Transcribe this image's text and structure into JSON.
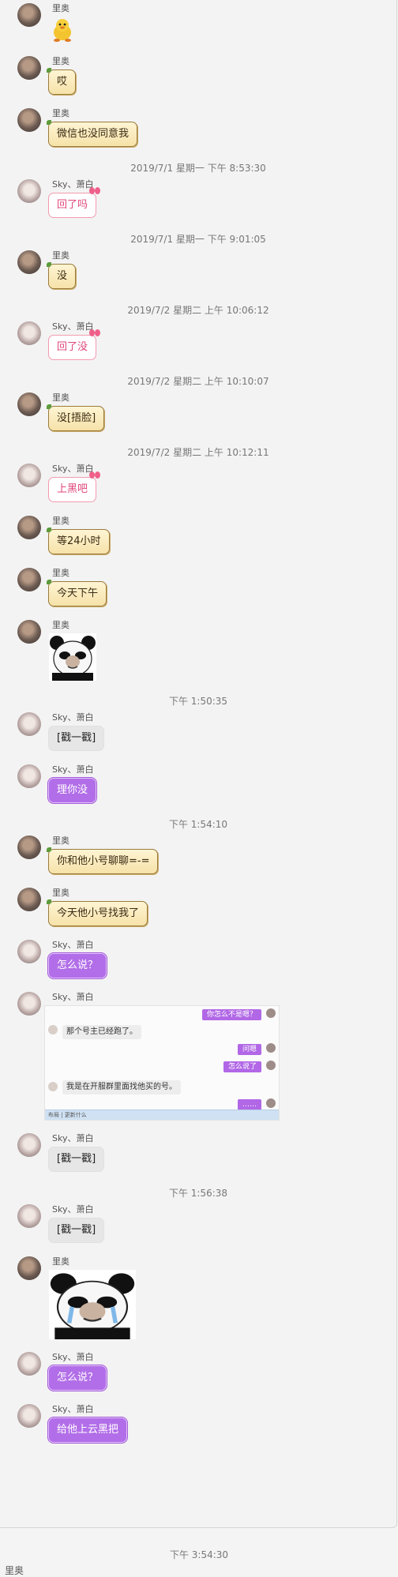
{
  "chat": {
    "messages": [
      {
        "type": "sticker-duck",
        "sender": "里奥"
      },
      {
        "type": "text",
        "sender": "里奥",
        "text": "哎"
      },
      {
        "type": "text",
        "sender": "里奥",
        "text": "微信也没同意我"
      },
      {
        "type": "time",
        "text": "2019/7/1 星期一 下午 8:53:30"
      },
      {
        "type": "text-pink",
        "sender": "Sky、萧白",
        "text": "回了吗"
      },
      {
        "type": "time",
        "text": "2019/7/1 星期一 下午 9:01:05"
      },
      {
        "type": "text",
        "sender": "里奥",
        "text": "没"
      },
      {
        "type": "time",
        "text": "2019/7/2 星期二 上午 10:06:12"
      },
      {
        "type": "text-pink",
        "sender": "Sky、萧白",
        "text": "回了没"
      },
      {
        "type": "time",
        "text": "2019/7/2 星期二 上午 10:10:07"
      },
      {
        "type": "text",
        "sender": "里奥",
        "text": "没[捂脸]"
      },
      {
        "type": "time",
        "text": "2019/7/2 星期二 上午 10:12:11"
      },
      {
        "type": "text-pink",
        "sender": "Sky、萧白",
        "text": "上黑吧"
      },
      {
        "type": "text",
        "sender": "里奥",
        "text": "等24小时"
      },
      {
        "type": "text",
        "sender": "里奥",
        "text": "今天下午"
      },
      {
        "type": "sticker-panda-small",
        "sender": "里奥"
      },
      {
        "type": "time",
        "text": "下午 1:50:35"
      },
      {
        "type": "text-gray",
        "sender": "Sky、萧白",
        "text": "[戳一戳]"
      },
      {
        "type": "text-purple",
        "sender": "Sky、萧白",
        "text": "理你没"
      },
      {
        "type": "time",
        "text": "下午 1:54:10"
      },
      {
        "type": "text",
        "sender": "里奥",
        "text": "你和他小号聊聊=-="
      },
      {
        "type": "text",
        "sender": "里奥",
        "text": "今天他小号找我了"
      },
      {
        "type": "text-purple",
        "sender": "Sky、萧白",
        "text": "怎么说？"
      },
      {
        "type": "screenshot",
        "sender": "Sky、萧白"
      },
      {
        "type": "text-gray",
        "sender": "Sky、萧白",
        "text": "[戳一戳]"
      },
      {
        "type": "time",
        "text": "下午 1:56:38"
      },
      {
        "type": "text-gray",
        "sender": "Sky、萧白",
        "text": "[戳一戳]"
      },
      {
        "type": "sticker-panda-big",
        "sender": "里奥"
      },
      {
        "type": "text-purple",
        "sender": "Sky、萧白",
        "text": "怎么说？"
      },
      {
        "type": "text-purple",
        "sender": "Sky、萧白",
        "text": "给他上云黑把"
      }
    ]
  },
  "screenshot_content": {
    "r1": "你怎么不是嗯？",
    "l1": "那个号主已经跑了。",
    "r2": "问嗯",
    "r3": "怎么说了",
    "l2": "我是在开服群里面找他买的号。",
    "r4": "……",
    "bar": "布局 | 更新什么"
  },
  "footer": {
    "time": "下午 3:54:30",
    "nick": "里奥"
  }
}
